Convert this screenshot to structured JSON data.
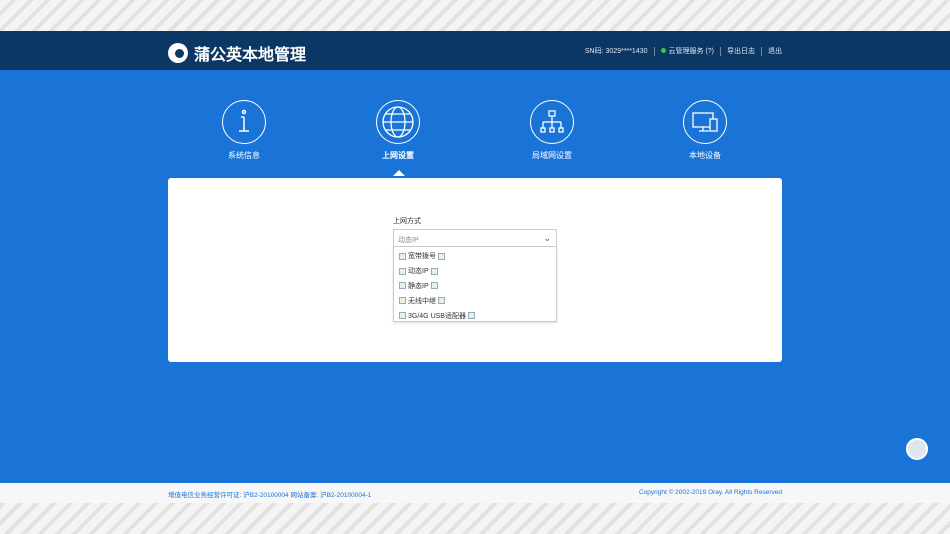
{
  "header": {
    "title": "蒲公英本地管理",
    "sn": "SN码: 3029****1430",
    "cloud": "云管理服务 (?)",
    "export_log": "导出日志",
    "logout": "退出"
  },
  "nav": [
    {
      "label": "系统信息"
    },
    {
      "label": "上网设置"
    },
    {
      "label": "局域网设置"
    },
    {
      "label": "本地设备"
    }
  ],
  "form": {
    "label": "上网方式",
    "selected": "动态IP",
    "options": [
      "宽带拨号",
      "动态IP",
      "静态IP",
      "无线中继",
      "3G/4G USB适配器"
    ]
  },
  "footer": {
    "license": "增值电信业务经营许可证: 沪B2-20100004 网站备案: 沪B2-20100004-1",
    "copyright": "Copyright © 2002-2019 Oray. All Rights Reserved"
  }
}
